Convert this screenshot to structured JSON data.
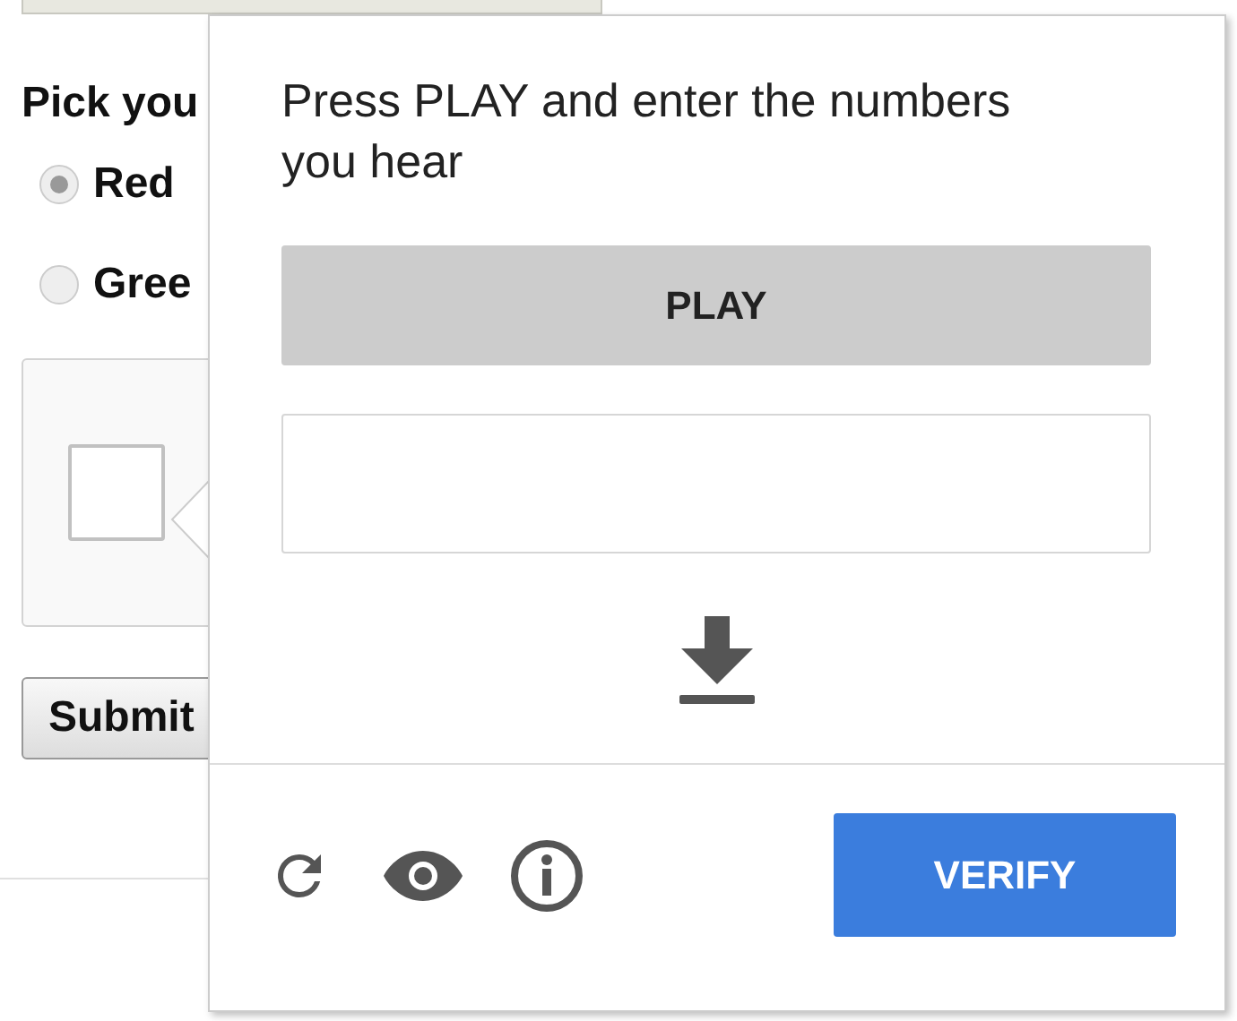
{
  "background_form": {
    "heading": "Pick you",
    "radios": [
      {
        "label": "Red",
        "selected": true
      },
      {
        "label": "Gree",
        "selected": false
      }
    ],
    "captcha_checkbox": {
      "checked": false
    },
    "submit_button": "Submit"
  },
  "challenge": {
    "instruction": "Press PLAY and enter the numbers you hear",
    "play_button": "PLAY",
    "verify_button": "VERIFY"
  }
}
